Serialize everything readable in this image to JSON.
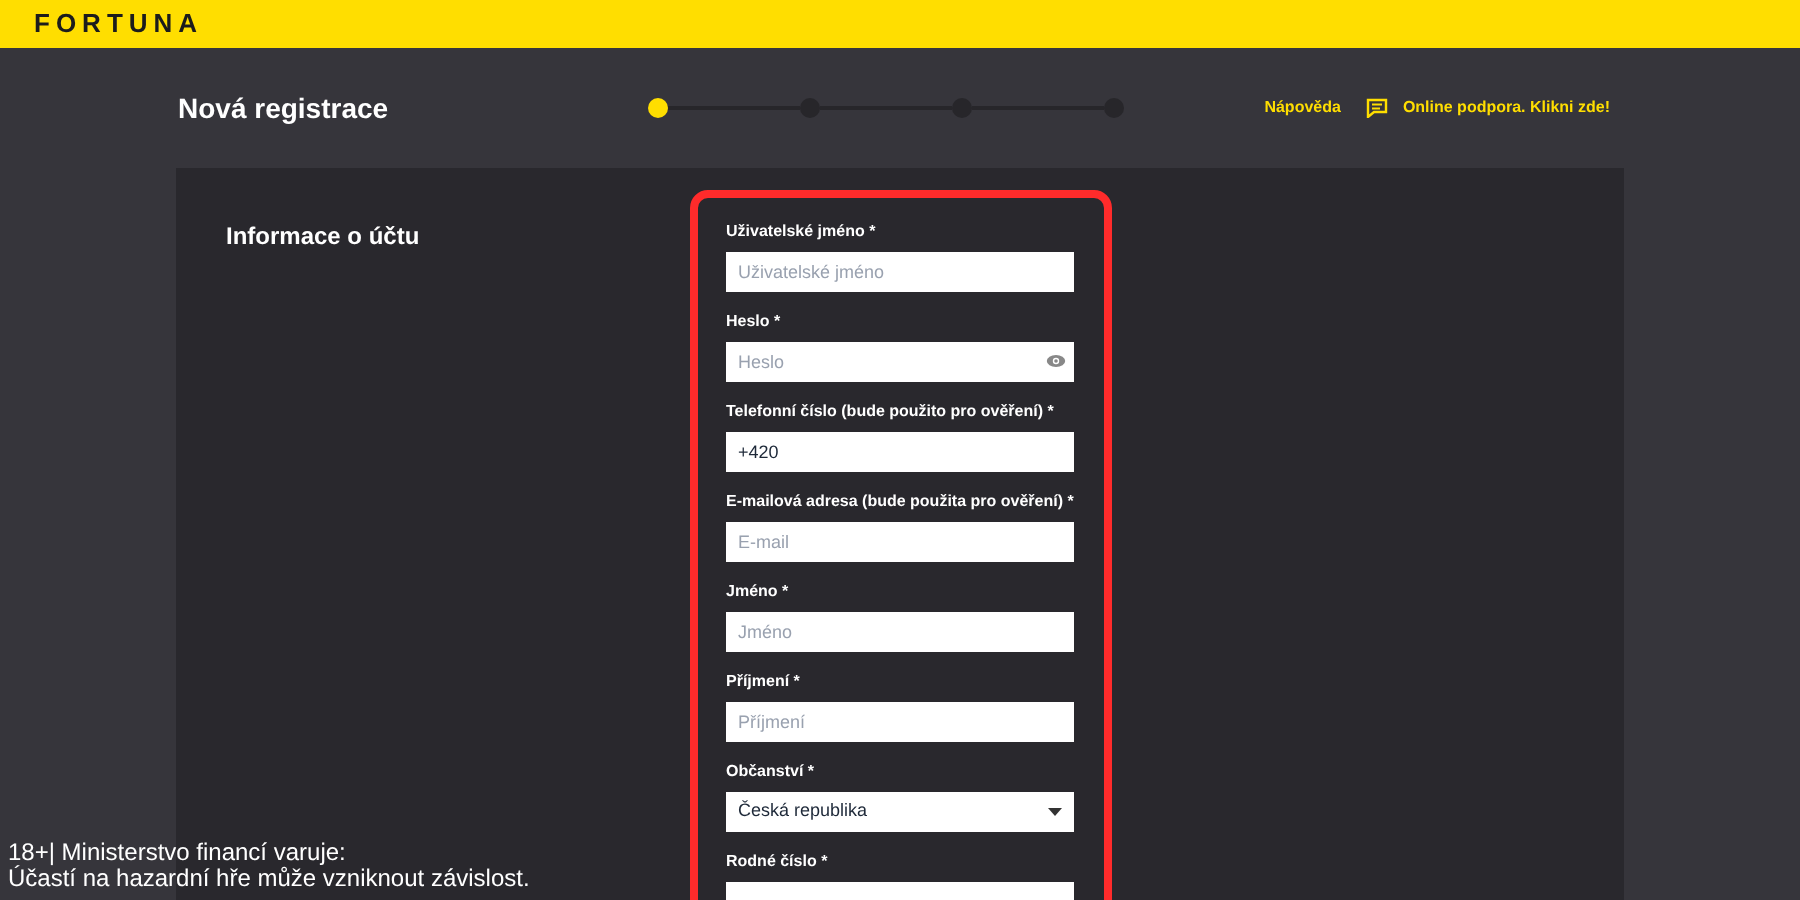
{
  "header": {
    "logo": "FORTUNA"
  },
  "title": "Nová registrace",
  "steps": [
    {
      "selected": true
    },
    {
      "selected": false
    },
    {
      "selected": false
    },
    {
      "selected": false
    }
  ],
  "help_link": "Nápověda",
  "support_link": "Online podpora. Klikni zde!",
  "section_title": "Informace o účtu",
  "fields": [
    {
      "kind": "text",
      "label": "Uživatelské jméno *",
      "placeholder": "Uživatelské jméno"
    },
    {
      "kind": "password",
      "label": "Heslo *",
      "placeholder": "Heslo"
    },
    {
      "kind": "text",
      "label": "Telefonní číslo (bude použito pro ověření) *",
      "value": "+420"
    },
    {
      "kind": "text",
      "label": "E-mailová adresa (bude použita pro ověření) *",
      "placeholder": "E-mail"
    },
    {
      "kind": "text",
      "label": "Jméno *",
      "placeholder": "Jméno"
    },
    {
      "kind": "text",
      "label": "Příjmení *",
      "placeholder": "Příjmení"
    },
    {
      "kind": "select",
      "label": "Občanství *",
      "value": "Česká republika"
    },
    {
      "kind": "text",
      "label": "Rodné číslo *"
    }
  ],
  "disclaimer": [
    "18+| Ministerstvo financí varuje:",
    "Účastí na hazardní hře může vzniknout závislost."
  ]
}
